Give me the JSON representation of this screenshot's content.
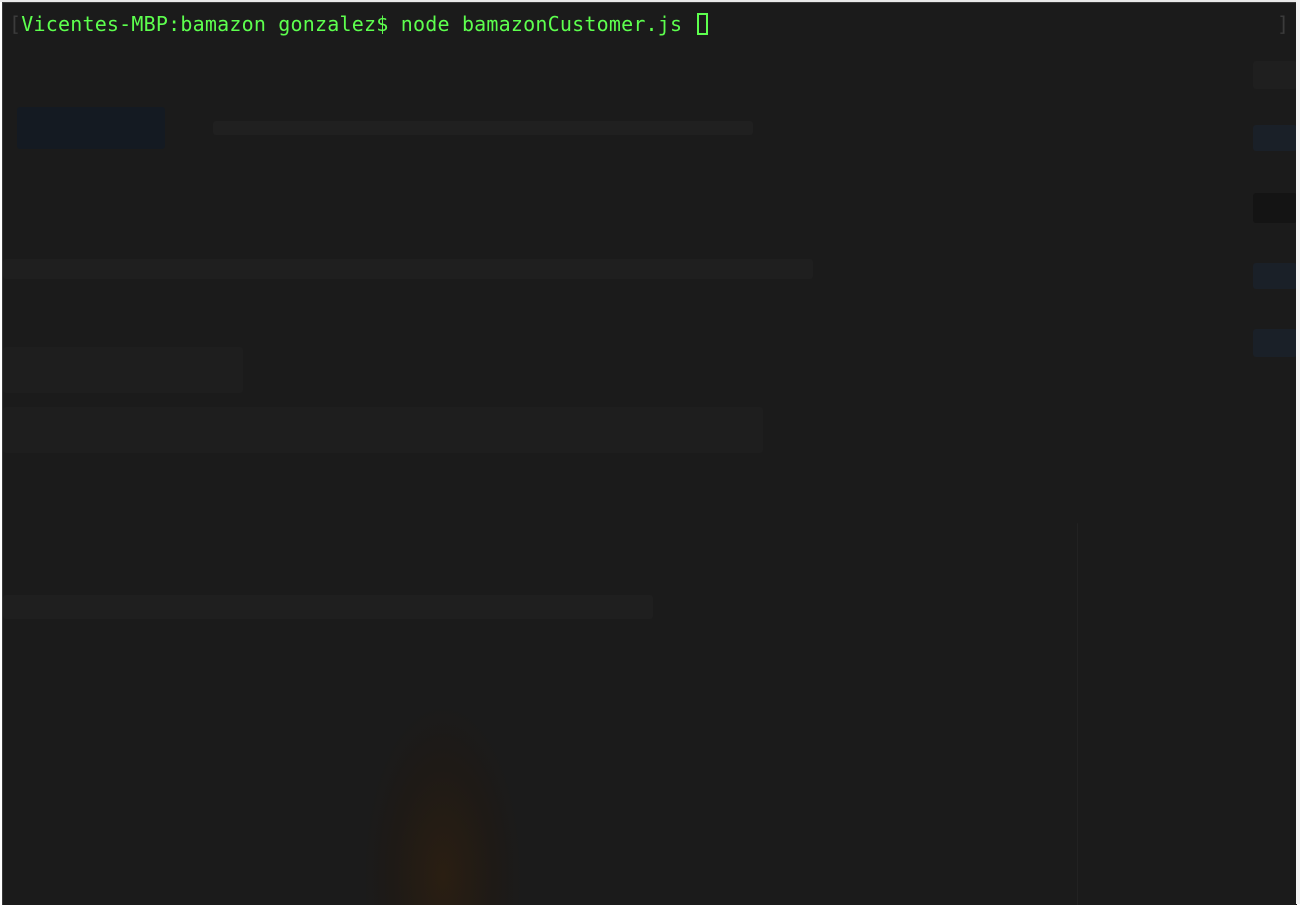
{
  "terminal": {
    "left_bracket": "[",
    "prompt": "Vicentes-MBP:bamazon gonzalez$",
    "command": "node bamazonCustomer.js",
    "right_bracket": "]"
  },
  "colors": {
    "background": "#1b1b1b",
    "text": "#5dff4e"
  }
}
